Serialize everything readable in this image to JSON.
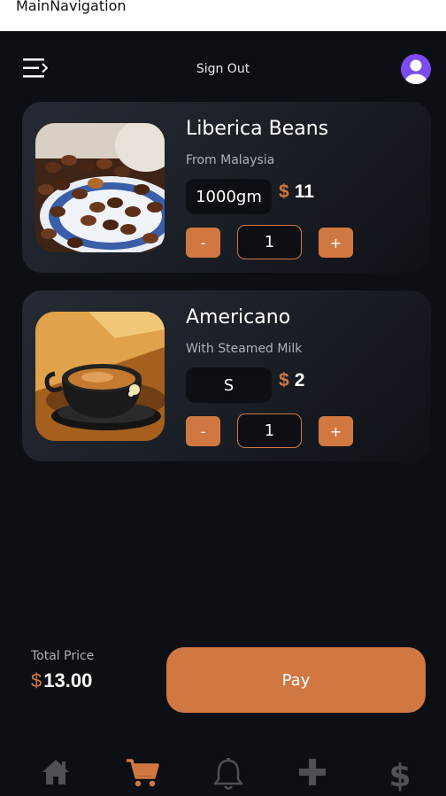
{
  "window": {
    "title": "MainNavigation"
  },
  "header": {
    "menu_icon": "menu-icon",
    "signout_label": "Sign Out",
    "avatar_icon": "user-avatar-icon"
  },
  "cart": {
    "items": [
      {
        "name": "Liberica Beans",
        "subtitle": "From Malaysia",
        "size": "1000gm",
        "currency": "$",
        "price": "11",
        "minus": "-",
        "quantity": "1",
        "plus": "+",
        "image": "coffee-beans-image"
      },
      {
        "name": "Americano",
        "subtitle": "With Steamed Milk",
        "size": "S",
        "currency": "$",
        "price": "2",
        "minus": "-",
        "quantity": "1",
        "plus": "+",
        "image": "coffee-cup-image"
      }
    ]
  },
  "footer": {
    "total_label": "Total Price",
    "currency": "$",
    "total_value": "13.00",
    "pay_label": "Pay"
  },
  "nav": {
    "items": [
      {
        "icon": "home-icon",
        "active": false
      },
      {
        "icon": "cart-icon",
        "active": true
      },
      {
        "icon": "bell-icon",
        "active": false
      },
      {
        "icon": "plus-icon",
        "active": false
      },
      {
        "icon": "dollar-icon",
        "active": false
      }
    ]
  },
  "colors": {
    "background": "#0c0f14",
    "accent": "#d17842",
    "card": "#21262e",
    "nav_inactive": "#4e5053"
  }
}
